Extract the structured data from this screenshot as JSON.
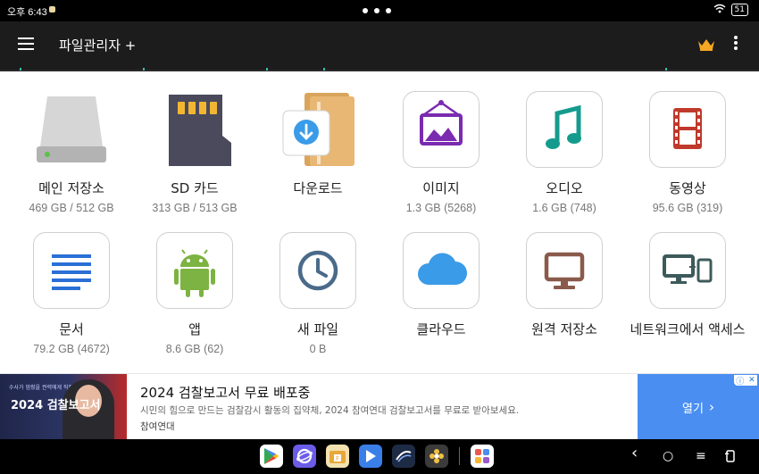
{
  "status_bar": {
    "time": "오후 6:43",
    "battery": "51"
  },
  "appbar": {
    "title": "파일관리자 +",
    "menu_icon": "hamburger-menu-icon",
    "premium_icon": "crown-icon",
    "more_icon": "more-vert-icon"
  },
  "colors": {
    "appbar": "#1c1c1c",
    "accent": "#3fb8b0",
    "crown": "#f5a623",
    "image": "#7b2bb0",
    "audio": "#159b8e",
    "video": "#c0392b",
    "docs": "#2a6fd6",
    "android": "#7cb342",
    "recent": "#4a6a8a",
    "cloud": "#3a9be8",
    "remote": "#8a5a4a",
    "network": "#3d5a5a",
    "ad_cta": "#4a8ef2"
  },
  "items": [
    {
      "label": "메인 저장소",
      "sub": "469 GB / 512 GB",
      "icon": "hard-drive-icon"
    },
    {
      "label": "SD 카드",
      "sub": "313 GB / 513 GB",
      "icon": "sd-card-icon"
    },
    {
      "label": "다운로드",
      "sub": "",
      "icon": "download-folder-icon"
    },
    {
      "label": "이미지",
      "sub": "1.3 GB (5268)",
      "icon": "image-icon"
    },
    {
      "label": "오디오",
      "sub": "1.6 GB (748)",
      "icon": "music-note-icon"
    },
    {
      "label": "동영상",
      "sub": "95.6 GB (319)",
      "icon": "film-icon"
    },
    {
      "label": "문서",
      "sub": "79.2 GB (4672)",
      "icon": "document-lines-icon"
    },
    {
      "label": "앱",
      "sub": "8.6 GB (62)",
      "icon": "android-icon"
    },
    {
      "label": "새 파일",
      "sub": "0 B",
      "icon": "clock-icon"
    },
    {
      "label": "클라우드",
      "sub": "",
      "icon": "cloud-icon"
    },
    {
      "label": "원격 저장소",
      "sub": "",
      "icon": "monitor-icon"
    },
    {
      "label": "네트워크에서 액세스",
      "sub": "",
      "icon": "network-devices-icon"
    }
  ],
  "ad": {
    "thumb_big": "2024 검찰보고서",
    "thumb_small": "수사가 멈췄을 권력에게 직접 던진 질문",
    "headline": "2024 검찰보고서 무료 배포중",
    "description": "시민의 힘으로 만드는 검찰감시 활동의 집약체, 2024 참여연대 검찰보고서를 무료로 받아보세요.",
    "advertiser": "참여연대",
    "cta": "열기"
  },
  "taskbar": {
    "apps": [
      "play-store-icon",
      "internet-browser-icon",
      "file-manager-icon",
      "video-player-icon",
      "swipe-app-icon",
      "settings-flower-icon",
      "app-drawer-icon"
    ],
    "nav": {
      "back": "‹",
      "home": "○",
      "recents": "≡"
    }
  }
}
